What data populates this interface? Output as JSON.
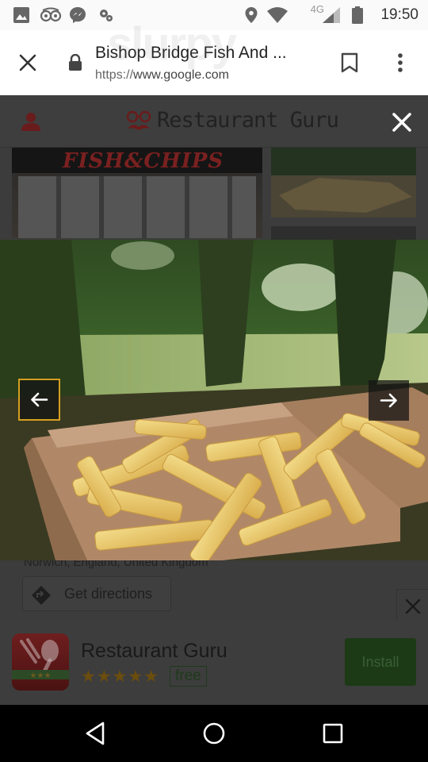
{
  "status_bar": {
    "network": "4G",
    "time": "19:50"
  },
  "browser": {
    "title": "Bishop Bridge Fish And ...",
    "url_scheme": "https://",
    "url_host": "www.google.com"
  },
  "site": {
    "brand": "Restaurant Guru",
    "sign_text": "FISH&CHIPS",
    "address_partial": "Norwich, England, United Kingdom",
    "directions_label": "Get directions",
    "watermark": "slurpy"
  },
  "app_banner": {
    "name": "Restaurant Guru",
    "stars": "★★★★★",
    "price": "free",
    "install_label": "Install"
  },
  "colors": {
    "accent_yellow": "#d4a020",
    "install_green": "#1c3a16",
    "brand_red": "#8a1f1f"
  }
}
